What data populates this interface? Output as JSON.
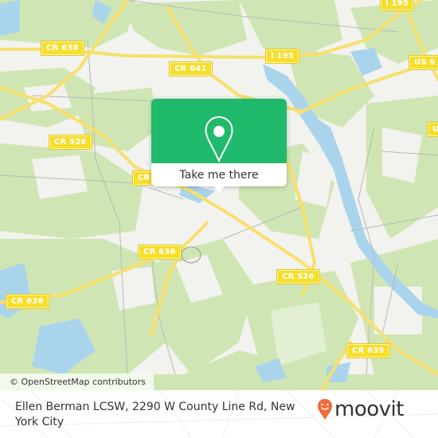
{
  "map": {
    "colors": {
      "land": "#f2f2ef",
      "forest": "#cfe6b4",
      "water": "#aad4ec",
      "major_road": "#f7e06b",
      "minor_road": "#b8b8b8"
    },
    "road_labels": [
      {
        "id": "cr-638",
        "text": "CR 638"
      },
      {
        "id": "cr-641",
        "text": "CR 641"
      },
      {
        "id": "i-195-left",
        "text": "I 195"
      },
      {
        "id": "i-195-top",
        "text": "I 195"
      },
      {
        "id": "us-9-upper",
        "text": "US 9"
      },
      {
        "id": "us-9-right",
        "text": "US"
      },
      {
        "id": "cr-526-left",
        "text": "CR 526"
      },
      {
        "id": "cr-partial",
        "text": "CR"
      },
      {
        "id": "cr-636-center",
        "text": "CR 636"
      },
      {
        "id": "cr-636-left",
        "text": "CR 636"
      },
      {
        "id": "cr-526-right",
        "text": "CR 526"
      },
      {
        "id": "cr-639",
        "text": "CR 639"
      }
    ],
    "attribution": "© OpenStreetMap contributors"
  },
  "popup": {
    "icon": "map-pin-icon",
    "button_label": "Take me there",
    "accent_color": "#1fba6b"
  },
  "footer": {
    "address": "Ellen Berman LCSW, 2290 W County Line Rd, New York City",
    "brand": "moovit",
    "brand_icon": "moovit-pin-icon",
    "brand_color": "#f26a3c"
  }
}
